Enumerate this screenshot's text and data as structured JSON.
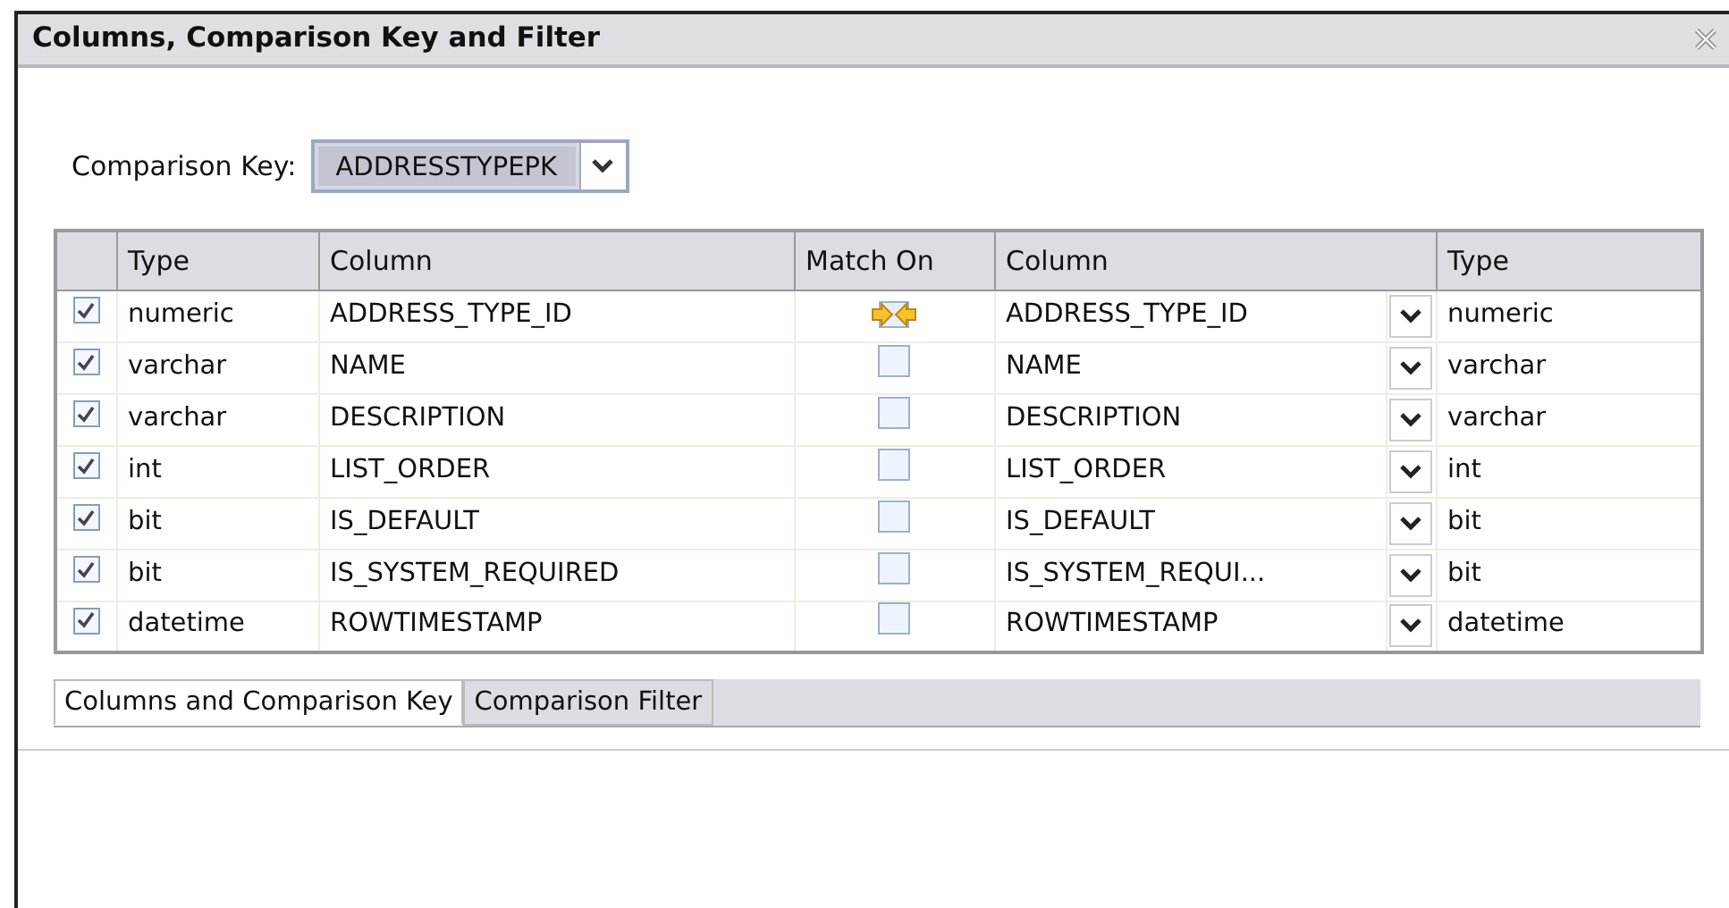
{
  "window": {
    "title": "Columns, Comparison Key and Filter"
  },
  "comparison_key": {
    "label": "Comparison Key:",
    "value": "ADDRESSTYPEPK"
  },
  "table": {
    "columns": [
      "Type",
      "Column",
      "Match On",
      "Column",
      "Type"
    ],
    "rows": [
      {
        "checked": true,
        "type": "numeric",
        "column": "ADDRESS_TYPE_ID",
        "matched": true,
        "target_column": "ADDRESS_TYPE_ID",
        "target_type": "numeric"
      },
      {
        "checked": true,
        "type": "varchar",
        "column": "NAME",
        "matched": false,
        "target_column": "NAME",
        "target_type": "varchar"
      },
      {
        "checked": true,
        "type": "varchar",
        "column": "DESCRIPTION",
        "matched": false,
        "target_column": "DESCRIPTION",
        "target_type": "varchar"
      },
      {
        "checked": true,
        "type": "int",
        "column": "LIST_ORDER",
        "matched": false,
        "target_column": "LIST_ORDER",
        "target_type": "int"
      },
      {
        "checked": true,
        "type": "bit",
        "column": "IS_DEFAULT",
        "matched": false,
        "target_column": "IS_DEFAULT",
        "target_type": "bit"
      },
      {
        "checked": true,
        "type": "bit",
        "column": "IS_SYSTEM_REQUIRED",
        "matched": false,
        "target_column": "IS_SYSTEM_REQUI...",
        "target_type": "bit"
      },
      {
        "checked": true,
        "type": "datetime",
        "column": "ROWTIMESTAMP",
        "matched": false,
        "target_column": "ROWTIMESTAMP",
        "target_type": "datetime"
      }
    ]
  },
  "tabs": [
    {
      "label": "Columns and Comparison Key",
      "selected": true
    },
    {
      "label": "Comparison Filter",
      "selected": false
    }
  ]
}
